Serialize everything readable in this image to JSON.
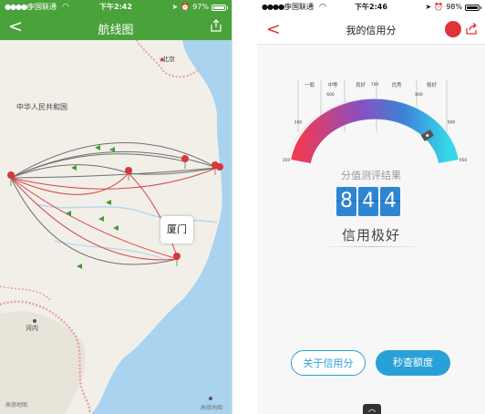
{
  "left": {
    "status": {
      "signal": "●●●●○",
      "carrier": "中国联通",
      "wifi": "WiFi",
      "time": "下午2:42",
      "battery_text": "97%",
      "battery_level": 0.97
    },
    "nav": {
      "title": "航线图"
    },
    "map": {
      "country_label": "中华人民共和国",
      "capital_label": "北京",
      "city_label": "厦门",
      "province_label": "河内",
      "watermark_left": "高德地图",
      "watermark_right": "高德地图"
    }
  },
  "right": {
    "status": {
      "signal": "●●●●○",
      "carrier": "中国联通",
      "wifi": "WiFi",
      "time": "下午2:46",
      "battery_text": "98%",
      "battery_level": 0.98
    },
    "nav": {
      "title": "我的信用分"
    },
    "gauge": {
      "bands": [
        "一般",
        "中等",
        "良好",
        "优秀",
        "极好"
      ],
      "ticks": [
        "350",
        "500",
        "600",
        "700",
        "800",
        "900",
        "950"
      ],
      "score_value": 844
    },
    "result_label": "分值测评结果",
    "score_digits": [
      "8",
      "4",
      "4"
    ],
    "level": "信用极好",
    "buttons": {
      "about": "关于信用分",
      "quota": "秒查额度"
    },
    "chevron": "︿"
  },
  "colors": {
    "green": "#4aa23a",
    "red": "#e0333a",
    "blue": "#29a1d8"
  }
}
